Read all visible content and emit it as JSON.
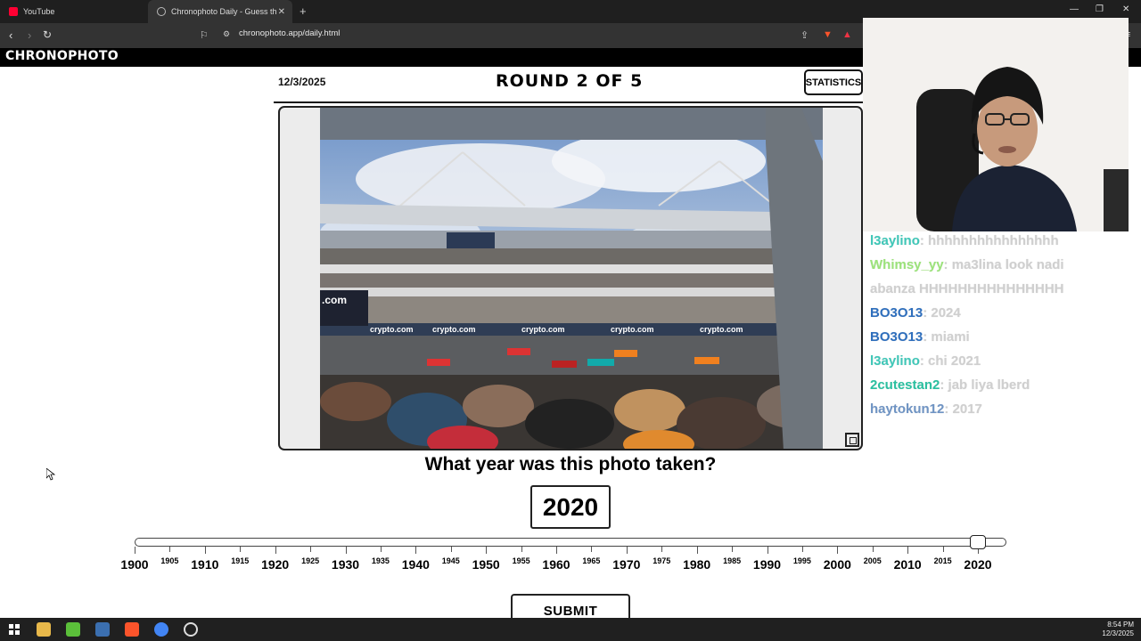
{
  "browser": {
    "tabs": [
      {
        "label": "YouTube"
      },
      {
        "label": "Chronophoto Daily - Guess the Y"
      }
    ],
    "address": "chronophoto.app/daily.html"
  },
  "site": {
    "logo": "CHRONOPHOTO"
  },
  "game": {
    "date": "12/3/2025",
    "round": "ROUND 2 OF 5",
    "statistics_label": "STATISTICS",
    "question": "What year was this photo taken?",
    "selected_year": "2020",
    "slider": {
      "min": 1900,
      "max": 2025,
      "value": 2020
    },
    "major_labels": [
      "1900",
      "1910",
      "1920",
      "1930",
      "1940",
      "1950",
      "1960",
      "1970",
      "1980",
      "1990",
      "2000",
      "2010",
      "2020"
    ],
    "minor_labels": [
      "1905",
      "1915",
      "1925",
      "1935",
      "1945",
      "1955",
      "1965",
      "1975",
      "1985",
      "1995",
      "2005",
      "2015"
    ],
    "submit_label": "SUBMIT",
    "photo_sign": "crypto.com",
    "photo_partial": ".com"
  },
  "chat": {
    "messages": [
      {
        "user": "l3aylino",
        "text": "hhhhhhhhhhhhhhhh",
        "color": "#3fc7b8"
      },
      {
        "user": "Whimsy_yy",
        "text": "ma3lina look nadi",
        "color": "#9be37a"
      },
      {
        "user": "",
        "text": "abanza HHHHHHHHHHHHHHH",
        "color": "#cfcfcf"
      },
      {
        "user": "BO3O13",
        "text": "2024",
        "color": "#2f6fbd"
      },
      {
        "user": "BO3O13",
        "text": "miami",
        "color": "#2f6fbd"
      },
      {
        "user": "l3aylino",
        "text": "chi 2021",
        "color": "#3fc7b8"
      },
      {
        "user": "2cutestan2",
        "text": "jab liya lberd",
        "color": "#2ac0a0"
      },
      {
        "user": "haytokun12",
        "text": "2017",
        "color": "#6f94c4"
      }
    ]
  },
  "taskbar": {
    "time": "8:54 PM",
    "date": "12/3/2025"
  }
}
